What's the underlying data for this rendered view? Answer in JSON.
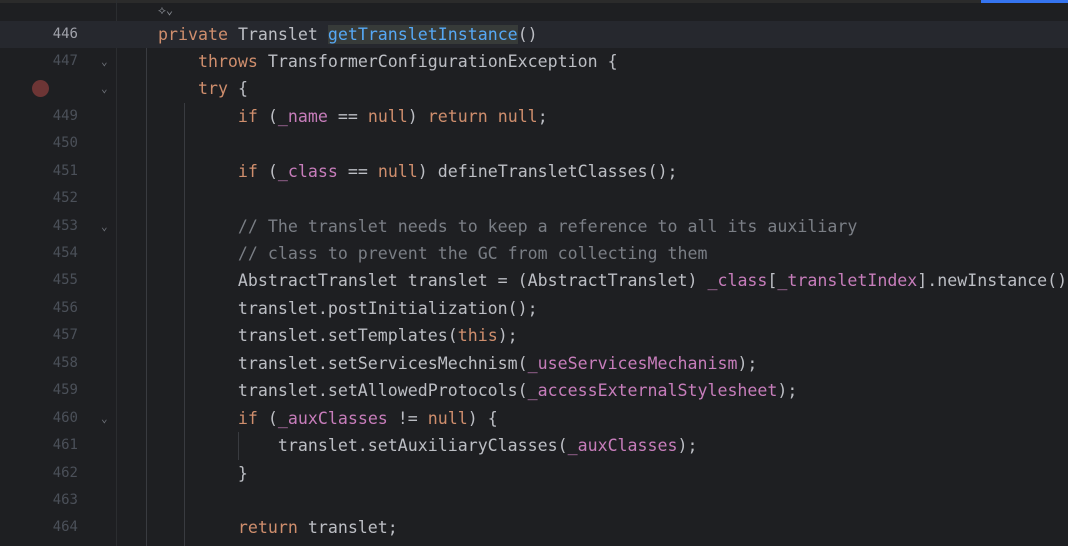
{
  "editor": {
    "accent_color": "#3574f0",
    "breakpoint_color": "#6d3535",
    "inlay_hint_icon": "ai-assistant-icon",
    "current_line": "446",
    "lines": [
      {
        "number": "446",
        "current": true,
        "tokens": [
          [
            "private ",
            "kw"
          ],
          [
            "Translet ",
            ""
          ],
          [
            "|",
            "caret"
          ],
          [
            "getTransletInstance",
            "fnsel"
          ],
          [
            "()",
            ""
          ]
        ]
      },
      {
        "number": "447",
        "fold": true,
        "tokens": [
          [
            "    throws ",
            "kw"
          ],
          [
            "TransformerConfigurationException {",
            ""
          ]
        ]
      },
      {
        "number": "",
        "breakpoint": true,
        "fold": true,
        "tokens": [
          [
            "    try ",
            "kw"
          ],
          [
            "{",
            ""
          ]
        ]
      },
      {
        "number": "449",
        "tokens": [
          [
            "        if ",
            "kw"
          ],
          [
            "(",
            ""
          ],
          [
            "_name",
            "fld"
          ],
          [
            " == ",
            ""
          ],
          [
            "null",
            "kw"
          ],
          [
            ") ",
            ""
          ],
          [
            "return null",
            "kw"
          ],
          [
            ";",
            ""
          ]
        ]
      },
      {
        "number": "450",
        "tokens": []
      },
      {
        "number": "451",
        "tokens": [
          [
            "        if ",
            "kw"
          ],
          [
            "(",
            ""
          ],
          [
            "_class",
            "fld"
          ],
          [
            " == ",
            ""
          ],
          [
            "null",
            "kw"
          ],
          [
            ") defineTransletClasses();",
            ""
          ]
        ]
      },
      {
        "number": "452",
        "tokens": []
      },
      {
        "number": "453",
        "fold": true,
        "tokens": [
          [
            "        // The translet needs to keep a reference to all its auxiliary",
            "cm"
          ]
        ]
      },
      {
        "number": "454",
        "tokens": [
          [
            "        // class to prevent the GC from collecting them",
            "cm"
          ]
        ]
      },
      {
        "number": "455",
        "tokens": [
          [
            "        AbstractTranslet translet = (AbstractTranslet) ",
            ""
          ],
          [
            "_class",
            "fld"
          ],
          [
            "[",
            ""
          ],
          [
            "_transletIndex",
            "fld"
          ],
          [
            "].newInstance()",
            ""
          ]
        ]
      },
      {
        "number": "456",
        "tokens": [
          [
            "        translet.postInitialization();",
            ""
          ]
        ]
      },
      {
        "number": "457",
        "tokens": [
          [
            "        translet.setTemplates(",
            ""
          ],
          [
            "this",
            "kw"
          ],
          [
            ");",
            ""
          ]
        ]
      },
      {
        "number": "458",
        "tokens": [
          [
            "        translet.setServicesMechnism(",
            ""
          ],
          [
            "_useServicesMechanism",
            "fld"
          ],
          [
            ");",
            ""
          ]
        ]
      },
      {
        "number": "459",
        "tokens": [
          [
            "        translet.setAllowedProtocols(",
            ""
          ],
          [
            "_accessExternalStylesheet",
            "fld"
          ],
          [
            ");",
            ""
          ]
        ]
      },
      {
        "number": "460",
        "fold": true,
        "tokens": [
          [
            "        if ",
            "kw"
          ],
          [
            "(",
            ""
          ],
          [
            "_auxClasses",
            "fld"
          ],
          [
            " != ",
            ""
          ],
          [
            "null",
            "kw"
          ],
          [
            ") {",
            ""
          ]
        ]
      },
      {
        "number": "461",
        "tokens": [
          [
            "            translet.setAuxiliaryClasses(",
            ""
          ],
          [
            "_auxClasses",
            "fld"
          ],
          [
            ");",
            ""
          ]
        ]
      },
      {
        "number": "462",
        "tokens": [
          [
            "        }",
            ""
          ]
        ]
      },
      {
        "number": "463",
        "tokens": []
      },
      {
        "number": "464",
        "tokens": [
          [
            "        return ",
            "kw"
          ],
          [
            "translet;",
            ""
          ]
        ]
      }
    ]
  }
}
